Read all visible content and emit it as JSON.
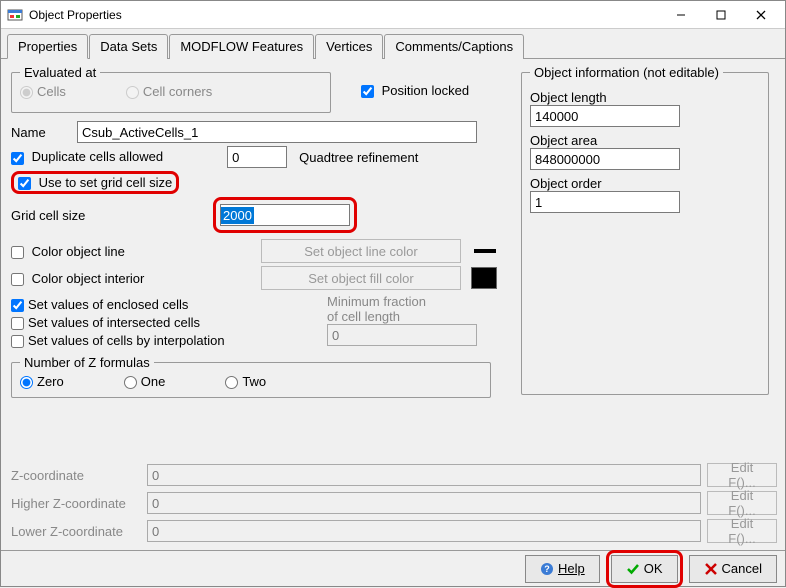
{
  "window": {
    "title": "Object Properties"
  },
  "tabs": {
    "items": [
      "Properties",
      "Data Sets",
      "MODFLOW Features",
      "Vertices",
      "Comments/Captions"
    ],
    "active": 0
  },
  "evaluated_at": {
    "legend": "Evaluated at",
    "cells": "Cells",
    "cell_corners": "Cell corners"
  },
  "position_locked": {
    "label": "Position locked",
    "checked": true
  },
  "name": {
    "label": "Name",
    "value": "Csub_ActiveCells_1"
  },
  "duplicate": {
    "label": "Duplicate cells allowed",
    "checked": true
  },
  "quadtree": {
    "label": "Quadtree refinement",
    "value": "0"
  },
  "use_grid_size": {
    "label": "Use to set grid cell size",
    "checked": true
  },
  "grid_cell_size": {
    "label": "Grid cell size",
    "value": "2000"
  },
  "color_line": {
    "label": "Color object line",
    "checked": false,
    "button": "Set object line color",
    "swatch": "#000000"
  },
  "color_interior": {
    "label": "Color object interior",
    "checked": false,
    "button": "Set object fill color",
    "swatch": "#000000"
  },
  "set_values": {
    "enclosed": {
      "label": "Set values of enclosed cells",
      "checked": true
    },
    "intersected": {
      "label": "Set values of intersected cells",
      "checked": false
    },
    "interpolation": {
      "label": "Set values of cells by interpolation",
      "checked": false
    }
  },
  "min_fraction": {
    "label1": "Minimum fraction",
    "label2": "of cell length",
    "value": "0"
  },
  "z_formulas": {
    "legend": "Number of Z formulas",
    "zero": "Zero",
    "one": "One",
    "two": "Two"
  },
  "z_coords": {
    "z": {
      "label": "Z-coordinate",
      "value": "0",
      "edit": "Edit F()..."
    },
    "hz": {
      "label": "Higher Z-coordinate",
      "value": "0",
      "edit": "Edit F()..."
    },
    "lz": {
      "label": "Lower Z-coordinate",
      "value": "0",
      "edit": "Edit F()..."
    }
  },
  "object_info": {
    "legend": "Object information (not editable)",
    "length": {
      "label": "Object length",
      "value": "140000"
    },
    "area": {
      "label": "Object area",
      "value": "848000000"
    },
    "order": {
      "label": "Object order",
      "value": "1"
    }
  },
  "footer": {
    "help": "Help",
    "ok": "OK",
    "cancel": "Cancel"
  }
}
